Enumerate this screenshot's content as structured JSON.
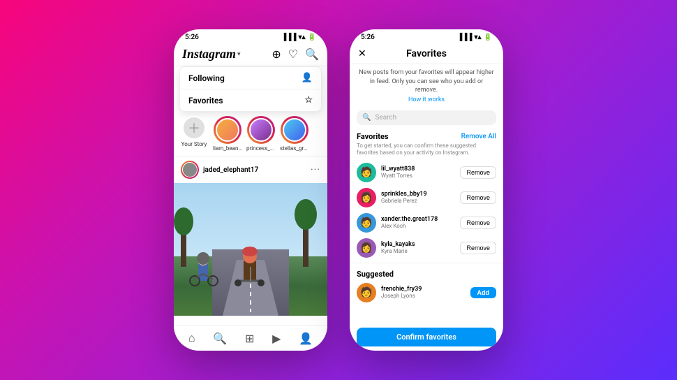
{
  "app": {
    "title": "Instagram",
    "chevron": "▾"
  },
  "phone1": {
    "status_time": "5:26",
    "header": {
      "logo": "Instagram",
      "add_icon": "⊕",
      "heart_icon": "♡",
      "search_icon": "🔍"
    },
    "dropdown": {
      "following_label": "Following",
      "following_icon": "👤",
      "favorites_label": "Favorites",
      "favorites_icon": "☆"
    },
    "stories": [
      {
        "label": "Your Story",
        "type": "your"
      },
      {
        "label": "liam_bean...",
        "type": "ring"
      },
      {
        "label": "princess_p...",
        "type": "ring"
      },
      {
        "label": "stellas_gr0...",
        "type": "ring"
      }
    ],
    "post": {
      "username": "jaded_elephant17",
      "more_icon": "···"
    },
    "bottom_nav": {
      "home": "⌂",
      "search": "🔍",
      "add": "⊞",
      "reels": "▶",
      "profile": "👤"
    }
  },
  "phone2": {
    "status_time": "5:26",
    "header": {
      "close_icon": "✕",
      "title": "Favorites"
    },
    "description": "New posts from your favorites will appear higher in feed.\nOnly you can see who you add or remove.",
    "how_it_works": "How it works",
    "search_placeholder": "Search",
    "favorites_section": "Favorites",
    "remove_all": "Remove All",
    "hint": "To get started, you can confirm these suggested favorites\nbased on your activity on Instagram.",
    "favorites_users": [
      {
        "handle": "lil_wyatt838",
        "name": "Wyatt Torres",
        "action": "Remove"
      },
      {
        "handle": "sprinkles_bby19",
        "name": "Gabriela Perez",
        "action": "Remove"
      },
      {
        "handle": "xander.the.great178",
        "name": "Alex Koch",
        "action": "Remove"
      },
      {
        "handle": "kyla_kayaks",
        "name": "Kyra Marie",
        "action": "Remove"
      }
    ],
    "suggested_section": "Suggested",
    "suggested_users": [
      {
        "handle": "frenchie_fry39",
        "name": "Joseph Lyons",
        "action": "Add"
      }
    ],
    "confirm_btn": "Confirm favorites"
  }
}
